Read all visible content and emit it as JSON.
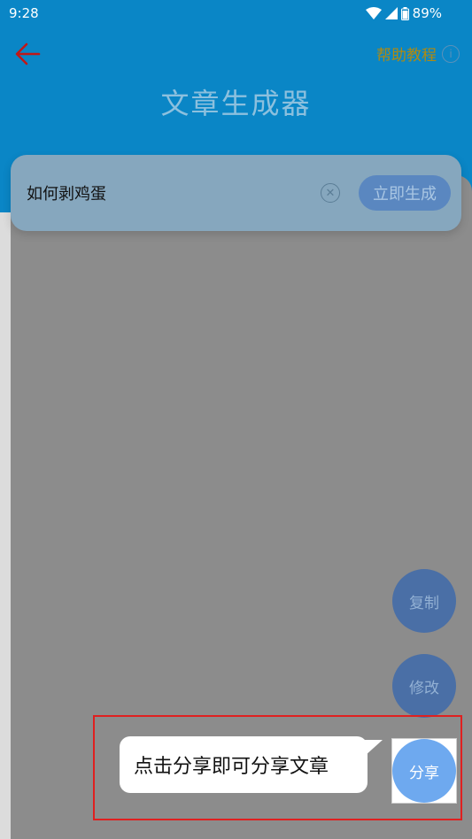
{
  "status_bar": {
    "time": "9:28",
    "battery": "89%"
  },
  "header": {
    "help_label": "帮助教程",
    "title": "文章生成器"
  },
  "input": {
    "value": "如何剥鸡蛋",
    "generate_label": "立即生成"
  },
  "fabs": {
    "copy_label": "复制",
    "edit_label": "修改",
    "share_label": "分享"
  },
  "tip": {
    "text": "点击分享即可分享文章"
  },
  "colors": {
    "header_bg": "#0a86c6",
    "accent_red": "#e02020",
    "share_blue": "#6ea9ef",
    "help_gold": "#b08a10"
  }
}
